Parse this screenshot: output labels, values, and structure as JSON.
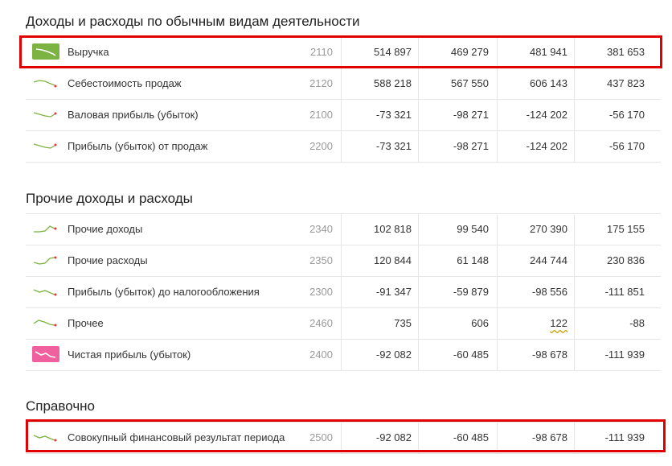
{
  "sections": [
    {
      "title": "Доходы и расходы по обычным видам деятельности",
      "rows": [
        {
          "label": "Выручка",
          "code": "2110",
          "values": [
            "514 897",
            "469 279",
            "481 941",
            "381 653"
          ],
          "spark": "green-badge-down",
          "highlighted": true
        },
        {
          "label": "Себестоимость продаж",
          "code": "2120",
          "values": [
            "588 218",
            "567 550",
            "606 143",
            "437 823"
          ],
          "spark": "green-line-down"
        },
        {
          "label": "Валовая прибыль (убыток)",
          "code": "2100",
          "values": [
            "-73 321",
            "-98 271",
            "-124 202",
            "-56 170"
          ],
          "spark": "green-line-dip-up"
        },
        {
          "label": "Прибыль (убыток) от продаж",
          "code": "2200",
          "values": [
            "-73 321",
            "-98 271",
            "-124 202",
            "-56 170"
          ],
          "spark": "green-line-dip-up"
        }
      ]
    },
    {
      "title": "Прочие доходы и расходы",
      "rows": [
        {
          "label": "Прочие доходы",
          "code": "2340",
          "values": [
            "102 818",
            "99 540",
            "270 390",
            "175 155"
          ],
          "spark": "green-line-rise"
        },
        {
          "label": "Прочие расходы",
          "code": "2350",
          "values": [
            "120 844",
            "61 148",
            "244 744",
            "230 836"
          ],
          "spark": "green-line-rise"
        },
        {
          "label": "Прибыль (убыток) до налогообложения",
          "code": "2300",
          "values": [
            "-91 347",
            "-59 879",
            "-98 556",
            "-111 851"
          ],
          "spark": "green-line-down"
        },
        {
          "label": "Прочее",
          "code": "2460",
          "values": [
            "735",
            "606",
            "122",
            "-88"
          ],
          "spark": "green-line-peak-down"
        },
        {
          "label": "Чистая прибыль (убыток)",
          "code": "2400",
          "values": [
            "-92 082",
            "-60 485",
            "-98 678",
            "-111 939"
          ],
          "spark": "pink-badge-down"
        }
      ]
    },
    {
      "title": "Справочно",
      "rows": [
        {
          "label": "Совокупный финансовый результат периода",
          "code": "2500",
          "values": [
            "-92 082",
            "-60 485",
            "-98 678",
            "-111 939"
          ],
          "spark": "green-line-down",
          "highlighted": true
        }
      ]
    }
  ],
  "colors": {
    "green": "#7cb342",
    "pink": "#f0609e",
    "highlight": "#e00000",
    "dot": "#e53935"
  }
}
